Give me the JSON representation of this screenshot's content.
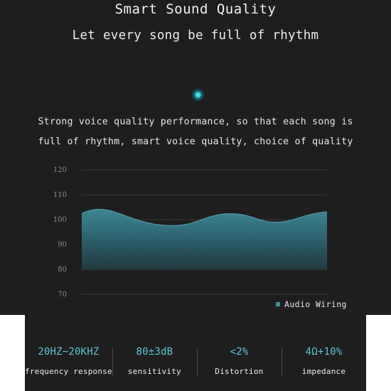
{
  "header": {
    "title": "Smart Sound Quality",
    "subtitle": "Let every song be full of rhythm"
  },
  "indicator": {
    "icon": "dot-indicator-icon",
    "color": "#37cfd4"
  },
  "description": {
    "line1": "Strong voice quality performance, so that each song is",
    "line2": "full of rhythm, smart voice quality, choice of quality"
  },
  "legend": {
    "marker_icon": "square-marker-icon",
    "label": "Audio Wiring",
    "color": "#3f8f9b"
  },
  "specs": [
    {
      "value": "20HZ~20KHZ",
      "caption": "frequency response"
    },
    {
      "value": "80±3dB",
      "caption": "sensitivity"
    },
    {
      "value": "<2%",
      "caption": "Distortion"
    },
    {
      "value": "4Ω+10%",
      "caption": "impedance"
    }
  ],
  "colors": {
    "background": "#1e1e1e",
    "page": "#ffffff",
    "accent": "#5fc4d6",
    "area_top": "#3a7b89",
    "area_bottom": "#20343a",
    "gridline": "#3a3a3a",
    "axis_label": "#8d8d8d"
  },
  "chart_data": {
    "type": "area",
    "title": "",
    "xlabel": "",
    "ylabel": "",
    "ylim": [
      70,
      120
    ],
    "yticks": [
      70,
      80,
      90,
      100,
      110,
      120
    ],
    "grid": true,
    "legend_position": "bottom-right",
    "baseline": 80,
    "series": [
      {
        "name": "Audio Wiring",
        "x": [
          0,
          5,
          10,
          15,
          20,
          25,
          30,
          35,
          40,
          45,
          50,
          55,
          60,
          65,
          70,
          75,
          80,
          85,
          90,
          95,
          100
        ],
        "values": [
          102.6,
          103.0,
          103.2,
          103.0,
          102.4,
          101.6,
          100.7,
          99.8,
          99.1,
          98.6,
          98.4,
          98.6,
          99.4,
          100.6,
          101.7,
          102.2,
          102.2,
          101.6,
          100.5,
          100.4,
          102.0
        ]
      }
    ]
  }
}
